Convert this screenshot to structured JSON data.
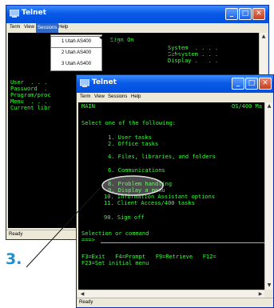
{
  "back_window": {
    "title": "Telnet",
    "menu": [
      "Term",
      "View",
      "Sessions",
      "Help"
    ],
    "active_menu": "Sessions",
    "sessions_menu": [
      "1 Utah AS400",
      "2 Utah AS400",
      "3 Utah AS400"
    ],
    "terminal_lines": [
      "Sign On",
      "System  . . . .",
      "Subsystem . . .",
      "Display . . . .",
      "User  . . .",
      "Password  .",
      "Program/proc",
      "Menu  . . .",
      "Current libr"
    ],
    "status": "Ready"
  },
  "front_window": {
    "title": "Telnet",
    "menu": [
      "Term",
      "View",
      "Sessions",
      "Help"
    ],
    "terminal": {
      "header_left": "MAIN",
      "header_right": "OS/400 Ma",
      "prompt": "Select one of the following:",
      "options": [
        "1. User tasks",
        "2. Office tasks",
        "4. Files, libraries, and folders",
        "6. Communications",
        "8. Problem handling",
        "9. Display a menu",
        "10. Information Assistant options",
        "11. Client Access/400 tasks",
        "90. Sign off"
      ],
      "selection_label": "Selection or command",
      "input_prompt": "===>",
      "fkeys_1": "F3=Exit   F4=Prompt   F9=Retrieve   F12=",
      "fkeys_2": "F23=Set initial menu"
    },
    "status": "Ready"
  },
  "callout": "3."
}
